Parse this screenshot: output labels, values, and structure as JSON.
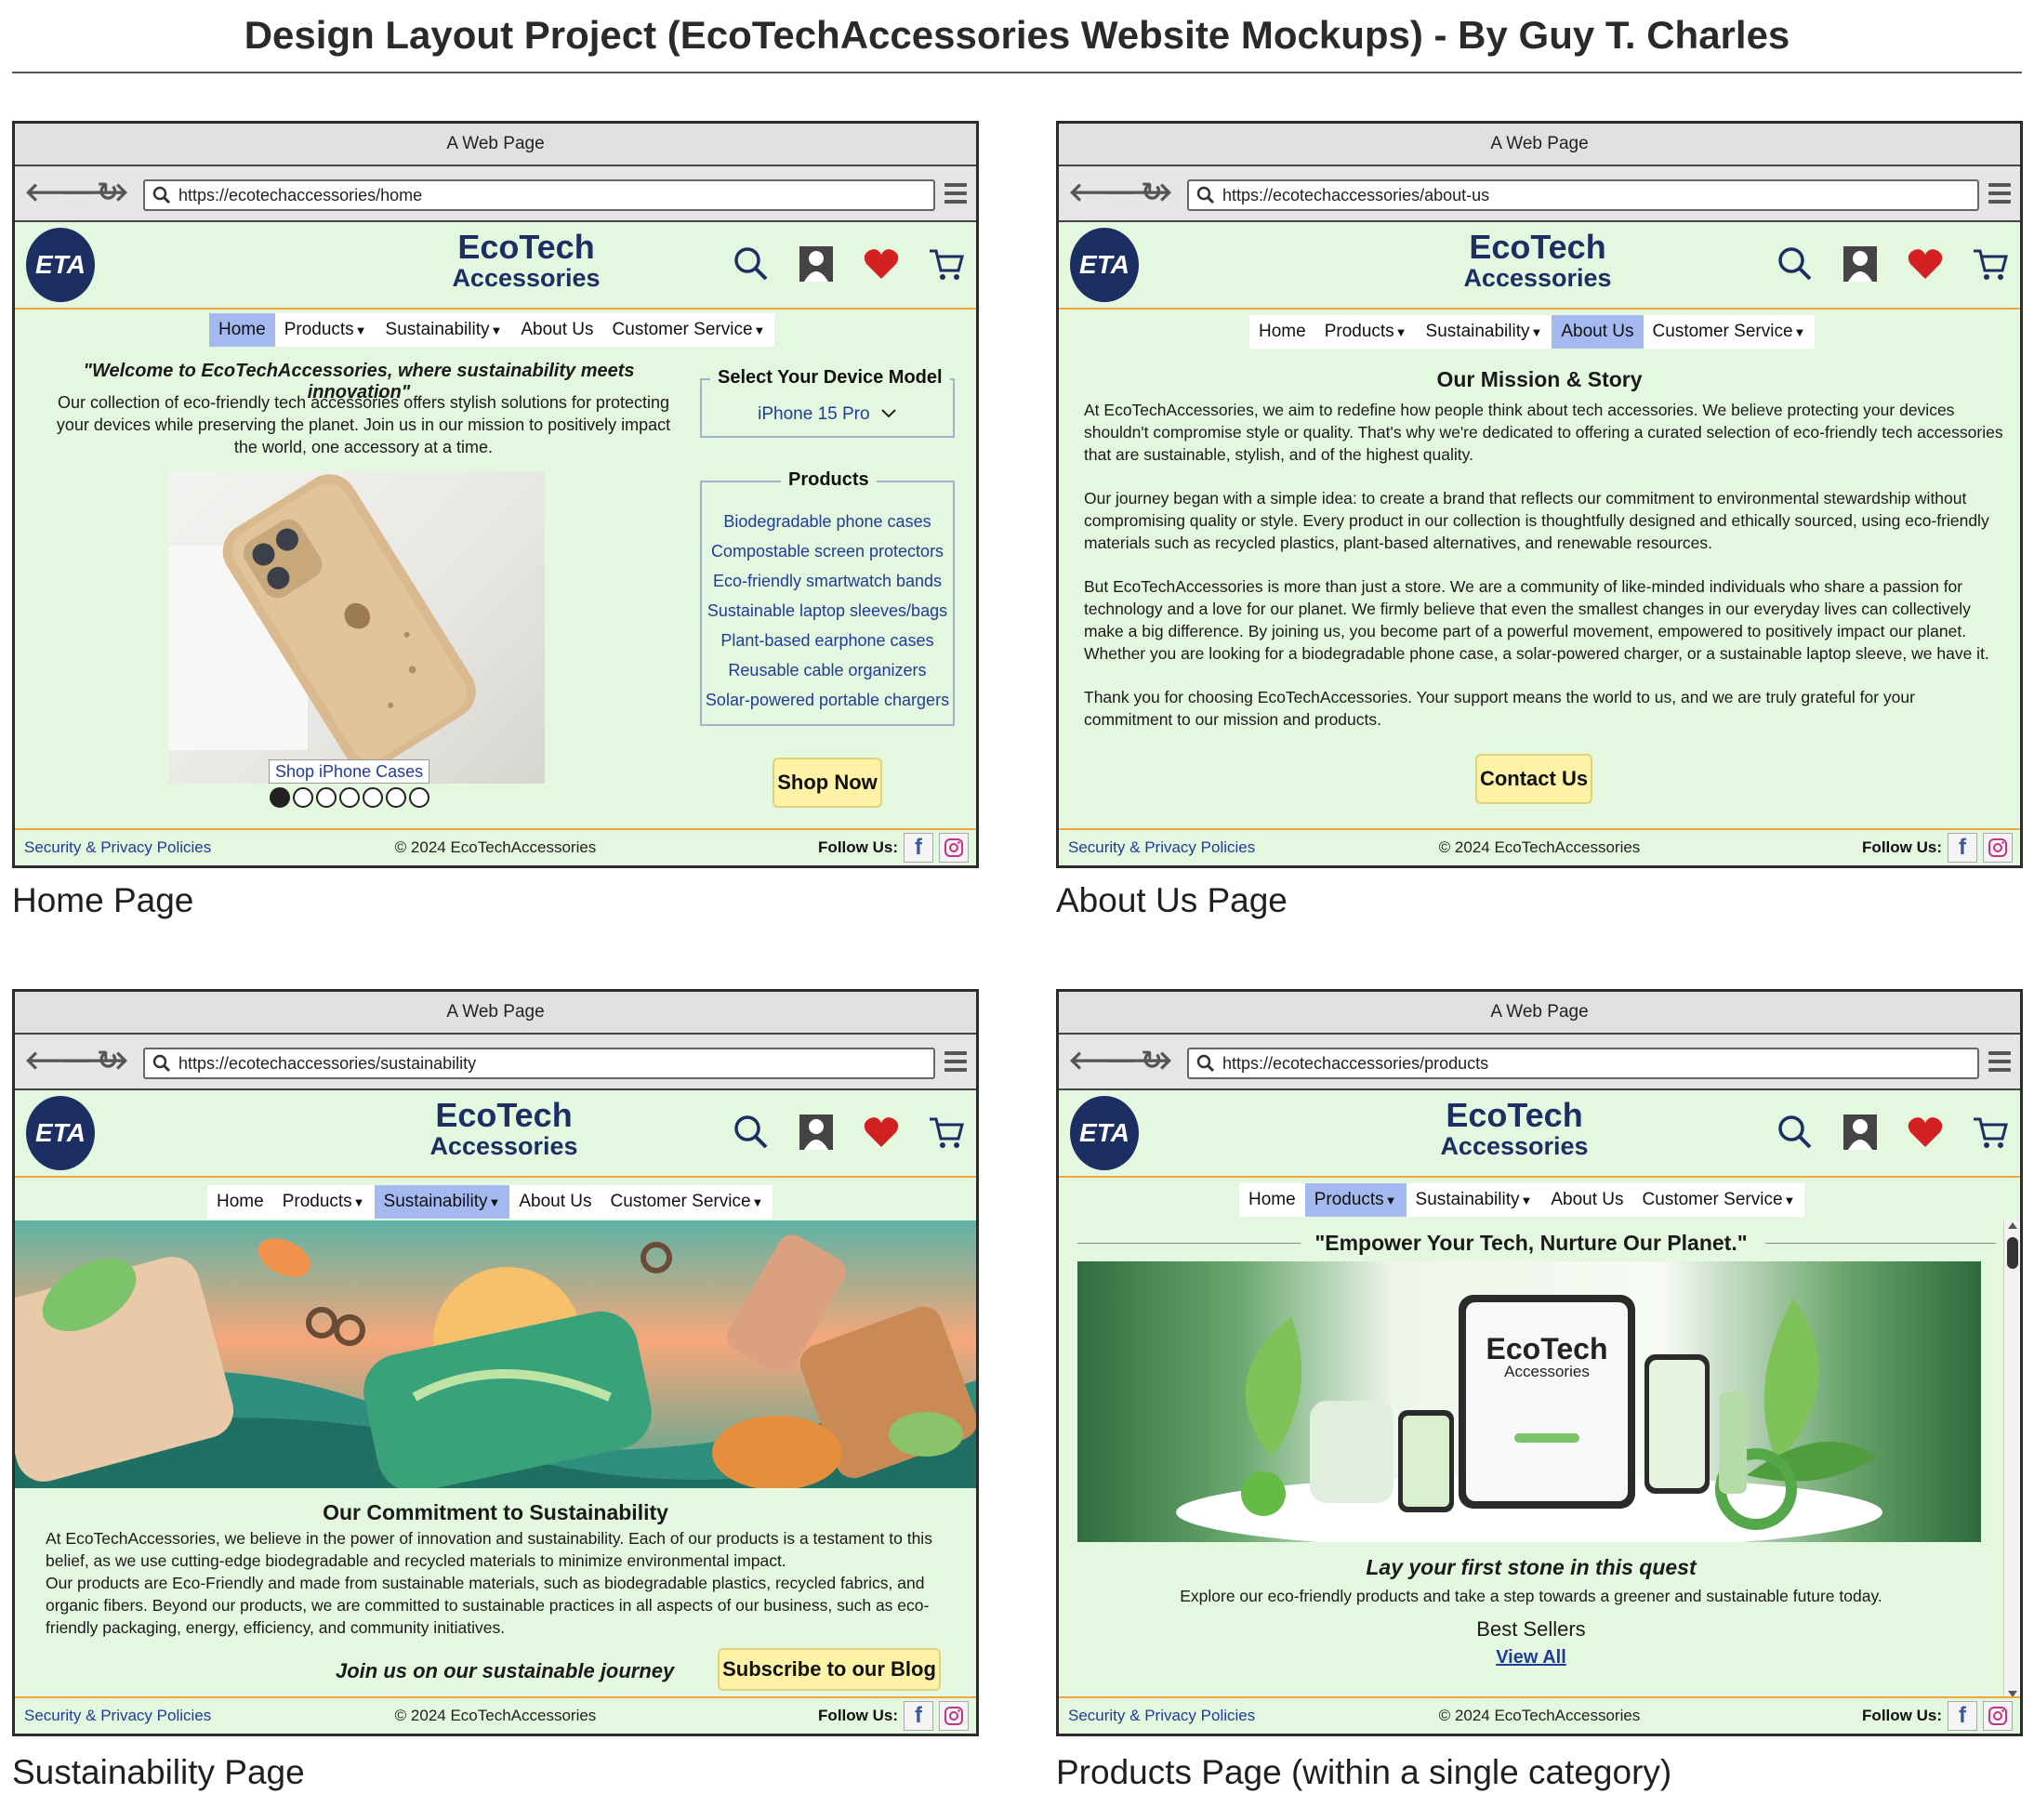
{
  "title": "Design Layout Project (EcoTechAccessories Website Mockups) - By Guy T. Charles",
  "browser": {
    "window_title": "A Web Page",
    "brand_line1": "EcoTech",
    "brand_line2": "Accessories",
    "logo_text": "ETA"
  },
  "nav": {
    "home": "Home",
    "products": "Products",
    "sustainability": "Sustainability",
    "about": "About Us",
    "customer_service": "Customer Service",
    "caret": "▼"
  },
  "footer": {
    "security": "Security & Privacy Policies",
    "copyright": "© 2024 EcoTechAccessories",
    "follow": "Follow Us:",
    "facebook": "f"
  },
  "home": {
    "caption": "Home Page",
    "url": "https://ecotechaccessories/home",
    "tagline": "\"Welcome to EcoTechAccessories, where sustainability meets innovation\"",
    "intro": "Our collection of eco-friendly tech accessories offers stylish solutions for protecting your devices while preserving the planet. Join us in our mission to positively impact the world, one accessory at a time.",
    "device_legend": "Select Your Device Model",
    "device_value": "iPhone 15 Pro",
    "products_legend": "Products",
    "product_links": [
      "Biodegradable phone cases",
      "Compostable screen protectors",
      "Eco-friendly smartwatch bands",
      "Sustainable laptop sleeves/bags",
      "Plant-based earphone cases",
      "Reusable cable organizers",
      "Solar-powered portable chargers"
    ],
    "image_link": "Shop iPhone Cases",
    "shop_now": "Shop Now",
    "carousel_total": 7,
    "carousel_active": 1
  },
  "about": {
    "caption": "About Us Page",
    "url": "https://ecotechaccessories/about-us",
    "heading": "Our Mission & Story",
    "paragraphs": [
      "At EcoTechAccessories, we aim to redefine how people think about tech accessories. We believe protecting your devices shouldn't compromise style or quality. That's why we're dedicated to offering a curated selection of eco-friendly tech accessories that are sustainable, stylish, and of the highest quality.",
      "Our journey began with a simple idea: to create a brand that reflects our commitment to environmental stewardship without compromising quality or style. Every product in our collection is thoughtfully designed and ethically sourced, using eco-friendly materials such as recycled plastics, plant-based alternatives, and renewable resources.",
      "But EcoTechAccessories is more than just a store. We are a community of like-minded individuals who share a passion for technology and a love for our planet. We firmly believe that even the smallest changes in our everyday lives can collectively make a big difference. By joining us, you become part of a powerful movement, empowered to positively impact our planet. Whether you are looking for a biodegradable phone case, a solar-powered charger, or a sustainable laptop sleeve, we have it.",
      "Thank you for choosing EcoTechAccessories. Your support means the world to us, and we are truly grateful for your commitment to our mission and products."
    ],
    "contact": "Contact Us"
  },
  "sustain": {
    "caption": "Sustainability Page",
    "url": "https://ecotechaccessories/sustainability",
    "heading": "Our Commitment to Sustainability",
    "p1": "At EcoTechAccessories, we believe in the power of innovation and sustainability. Each of our products is a testament to this belief, as we use cutting-edge biodegradable and recycled materials to minimize environmental impact.",
    "p2": "Our products are Eco-Friendly and made from sustainable materials, such as biodegradable plastics, recycled fabrics, and organic fibers. Beyond our products, we are committed to sustainable practices in all aspects of our business, such as eco-friendly packaging, energy, efficiency, and community initiatives.",
    "join": "Join us on our sustainable journey",
    "subscribe": "Subscribe to our Blog"
  },
  "products": {
    "caption": "Products Page (within a single category)",
    "url": "https://ecotechaccessories/products",
    "slogan": "\"Empower Your Tech, Nurture Our Planet.\"",
    "screen_brand1": "EcoTech",
    "screen_brand2": "Accessories",
    "quest": "Lay your first stone in this quest",
    "explore": "Explore our eco-friendly products and take a step towards a greener and sustainable future today.",
    "best_sellers": "Best Sellers",
    "view_all": "View All"
  },
  "icons": [
    "back-arrow-icon",
    "forward-arrow-icon",
    "reload-icon",
    "search-icon",
    "menu-icon",
    "user-icon",
    "heart-icon",
    "cart-icon",
    "facebook-icon",
    "instagram-icon",
    "chevron-down-icon"
  ],
  "colors": {
    "nav_active": "#a3b9ef",
    "page_bg": "#e4f7df",
    "brand": "#1b2f63",
    "accent_line": "#f0a63a",
    "cta": "#fdf2a6",
    "heart": "#d32020",
    "link": "#1f3c98"
  }
}
